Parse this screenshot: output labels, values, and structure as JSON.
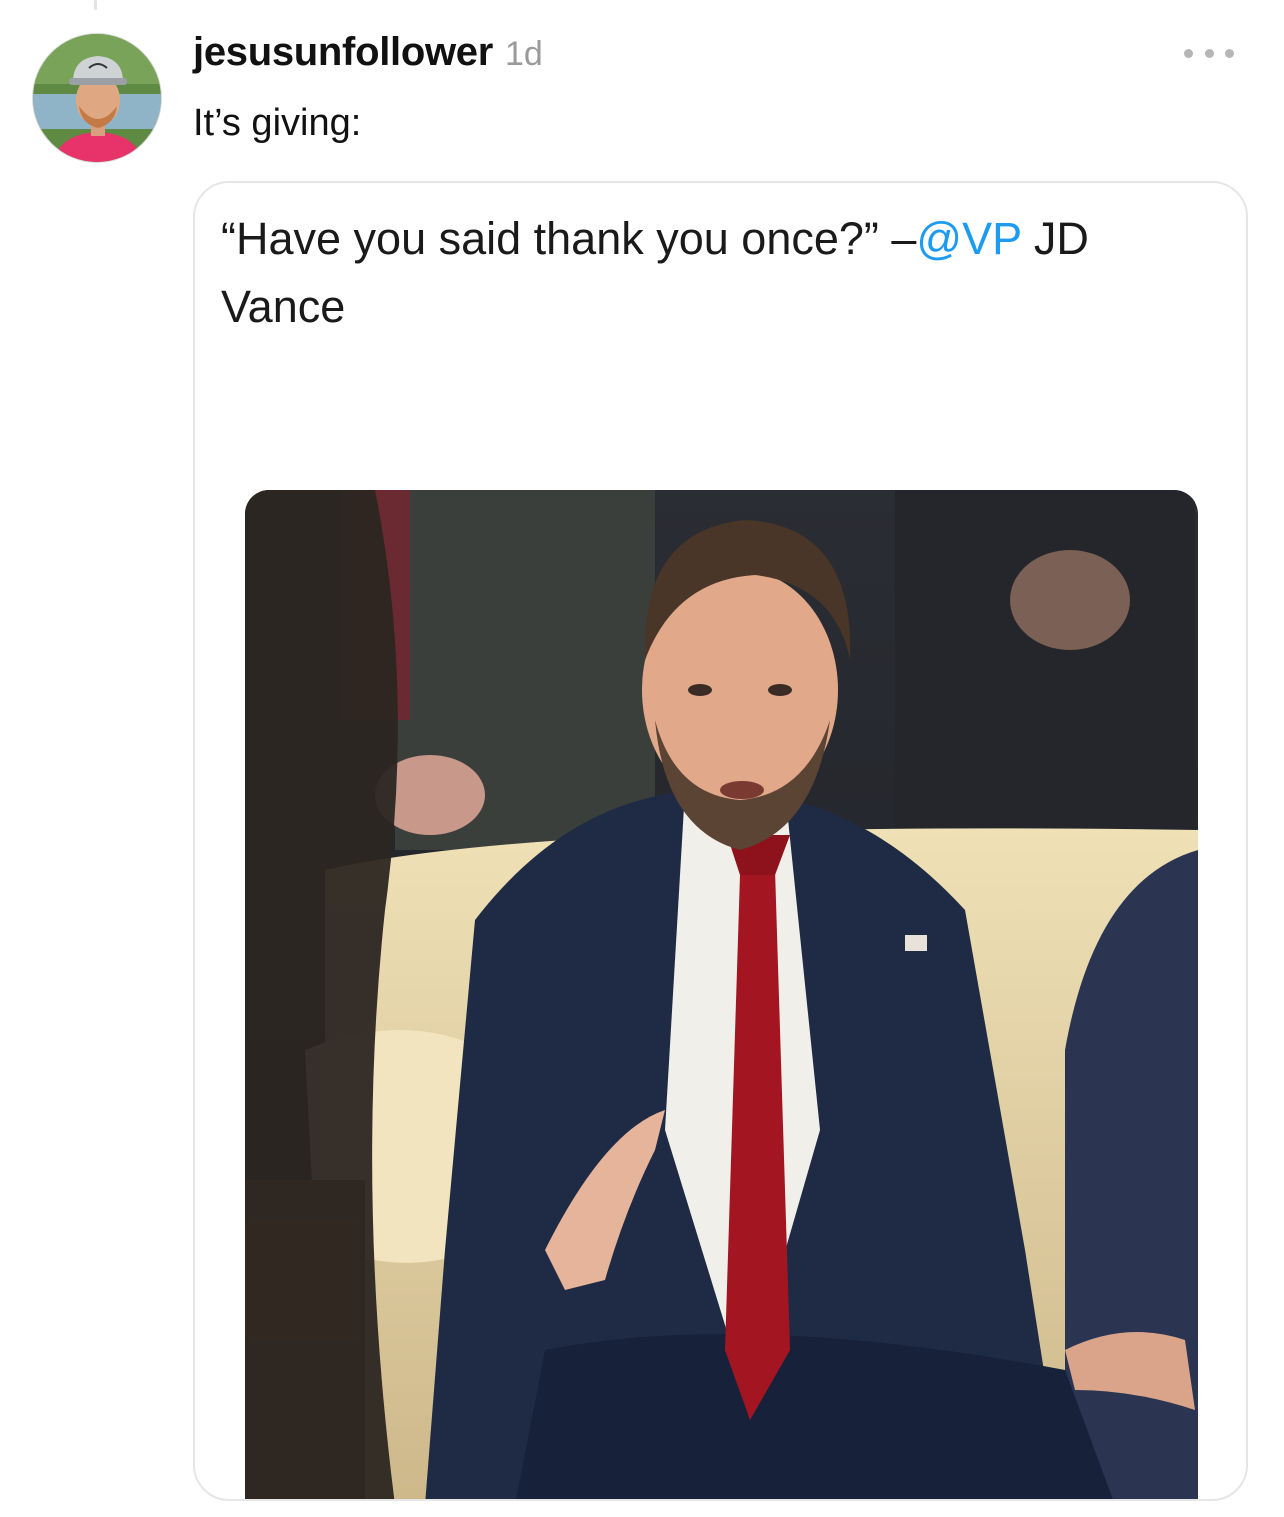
{
  "post": {
    "username": "jesusunfollower",
    "timestamp": "1d",
    "text": "It’s giving:",
    "more_icon": "ellipsis-icon"
  },
  "quote": {
    "prefix": "“Have you said thank you once?” –",
    "mention": "@VP",
    "suffix": " JD Vance"
  },
  "colors": {
    "mention": "#1d9bf0",
    "tie": "#a31621",
    "suit": "#1f2b44",
    "sofa": "#e3d2a3"
  }
}
